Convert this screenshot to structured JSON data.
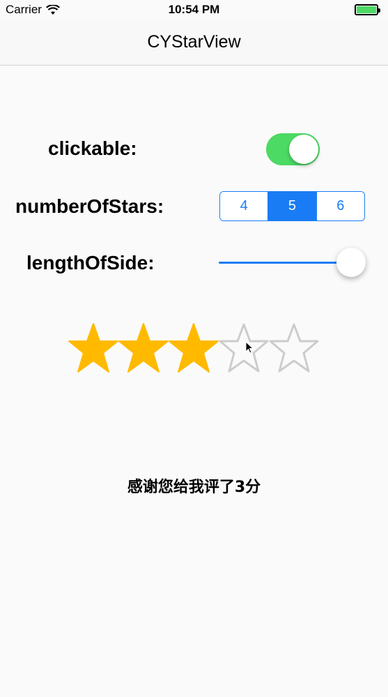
{
  "status_bar": {
    "carrier": "Carrier",
    "time": "10:54 PM",
    "wifi_icon": "wifi-icon",
    "battery_icon": "battery-icon",
    "battery_color": "#4cd964"
  },
  "nav": {
    "title": "CYStarView"
  },
  "settings": {
    "clickable": {
      "label": "clickable:",
      "on": true,
      "on_color": "#4cd964"
    },
    "number_of_stars": {
      "label": "numberOfStars:",
      "options": [
        "4",
        "5",
        "6"
      ],
      "selected": "5",
      "tint_color": "#1a7cf5"
    },
    "length_of_side": {
      "label": "lengthOfSide:",
      "value_fraction": 1.0,
      "tint_color": "#1a7cf5"
    }
  },
  "star_rating": {
    "count": 5,
    "rating": 3,
    "filled_color": "#ffba00",
    "empty_stroke_color": "#cccccc",
    "star_icon": "star-icon"
  },
  "rating_message": "感谢您给我评了3分"
}
